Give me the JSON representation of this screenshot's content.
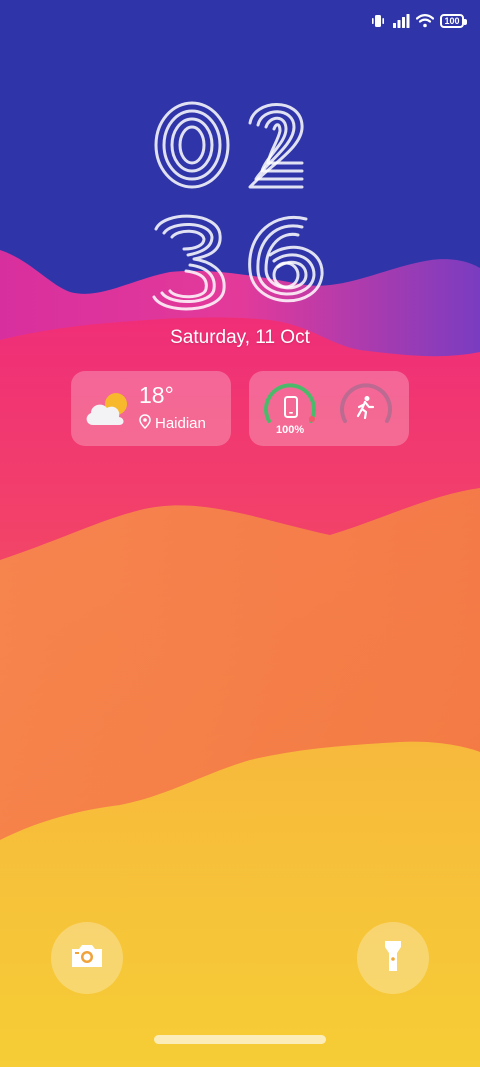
{
  "status_bar": {
    "icons": [
      "vibrate-icon",
      "signal-icon",
      "wifi-icon",
      "battery-icon"
    ],
    "battery_level": "100"
  },
  "clock": {
    "hours": "02",
    "minutes": "36"
  },
  "date": "Saturday, 11 Oct",
  "weather_widget": {
    "temperature": "18°",
    "location": "Haidian",
    "condition_icon": "partly-cloudy-icon"
  },
  "health_widget": {
    "device_battery_percent": "100%",
    "device_icon": "phone-icon",
    "activity_icon": "walking-icon"
  },
  "quick_actions": [
    {
      "name": "camera",
      "icon": "camera-icon"
    },
    {
      "name": "flashlight",
      "icon": "flashlight-icon"
    }
  ],
  "colors": {
    "sky": "#2f35a8",
    "magenta": "#e6308f",
    "red": "#f4535c",
    "orange": "#f5863f",
    "yellow": "#f6c934",
    "battery_ring": "#4cb86a"
  }
}
